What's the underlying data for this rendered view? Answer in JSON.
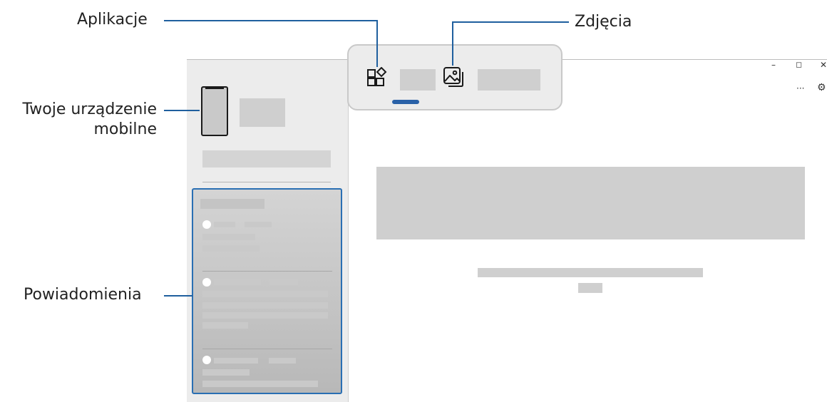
{
  "callouts": {
    "apps": "Aplikacje",
    "photos": "Zdjęcia",
    "device": "Twoje urządzenie mobilne",
    "notifications": "Powiadomienia"
  },
  "window": {
    "minimize": "–",
    "maximize": "◻",
    "close": "✕",
    "more": "···",
    "settings": "⚙"
  },
  "icons": {
    "apps": "apps-grid-icon",
    "photos": "photos-icon",
    "settings": "gear-icon"
  },
  "colors": {
    "accent": "#1f5f9e",
    "active_tab": "#2a62a8",
    "placeholder": "#c8c8c8",
    "sidebar": "#ececec"
  }
}
